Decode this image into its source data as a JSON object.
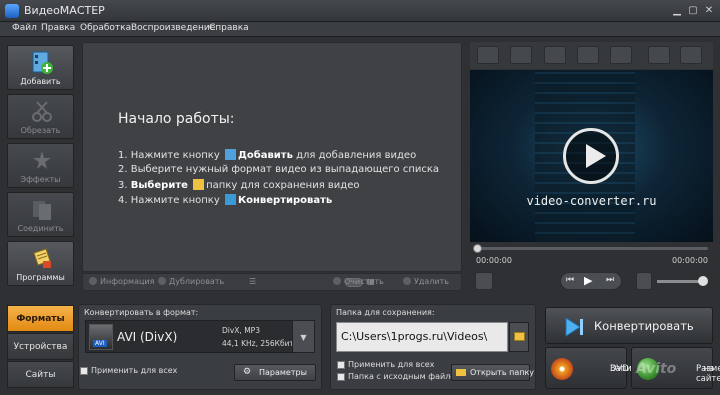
{
  "window": {
    "title": "ВидеоМАСТЕР"
  },
  "menu": [
    "Файл",
    "Правка",
    "Обработка",
    "Воспроизведение",
    "Справка"
  ],
  "tools": {
    "add": "Добавить",
    "trim": "Обрезать",
    "effects": "Эффекты",
    "join": "Соединить",
    "programs": "Программы"
  },
  "start": {
    "heading": "Начало работы:",
    "s1a": "1. Нажмите кнопку",
    "s1b": "Добавить",
    "s1c": "для добавления видео",
    "s2": "2. Выберите нужный формат видео из выпадающего списка",
    "s3a": "3.",
    "s3b": "Выберите",
    "s3c": "папку для сохранения видео",
    "s4a": "4. Нажмите кнопку",
    "s4b": "Конвертировать"
  },
  "listbar": {
    "info": "Информация",
    "dup": "Дублировать",
    "clear": "Очистить",
    "remove": "Удалить"
  },
  "player": {
    "caption": "video-converter.ru",
    "time_start": "00:00:00",
    "time_end": "00:00:00"
  },
  "tabs": [
    "Форматы",
    "Устройства",
    "Сайты"
  ],
  "format": {
    "label": "Конвертировать в формат:",
    "name": "AVI (DivX)",
    "codec": "DivX, MP3",
    "audio": "44,1 KHz, 256Кбит",
    "badge": "AVI",
    "apply_all": "Применить для всех",
    "params": "Параметры"
  },
  "save": {
    "label": "Папка для сохранения:",
    "path": "C:\\Users\\1progs.ru\\Videos\\",
    "apply_all": "Применить для всех",
    "source_folder": "Папка с исходным файлом",
    "open": "Открыть папку"
  },
  "actions": {
    "convert": "Конвертировать",
    "burn1": "Записать",
    "burn2": "DVD",
    "share1": "Разместить",
    "share2": "на сайте"
  },
  "watermark": "Avito",
  "colors": {
    "accent": "#e8951a"
  }
}
